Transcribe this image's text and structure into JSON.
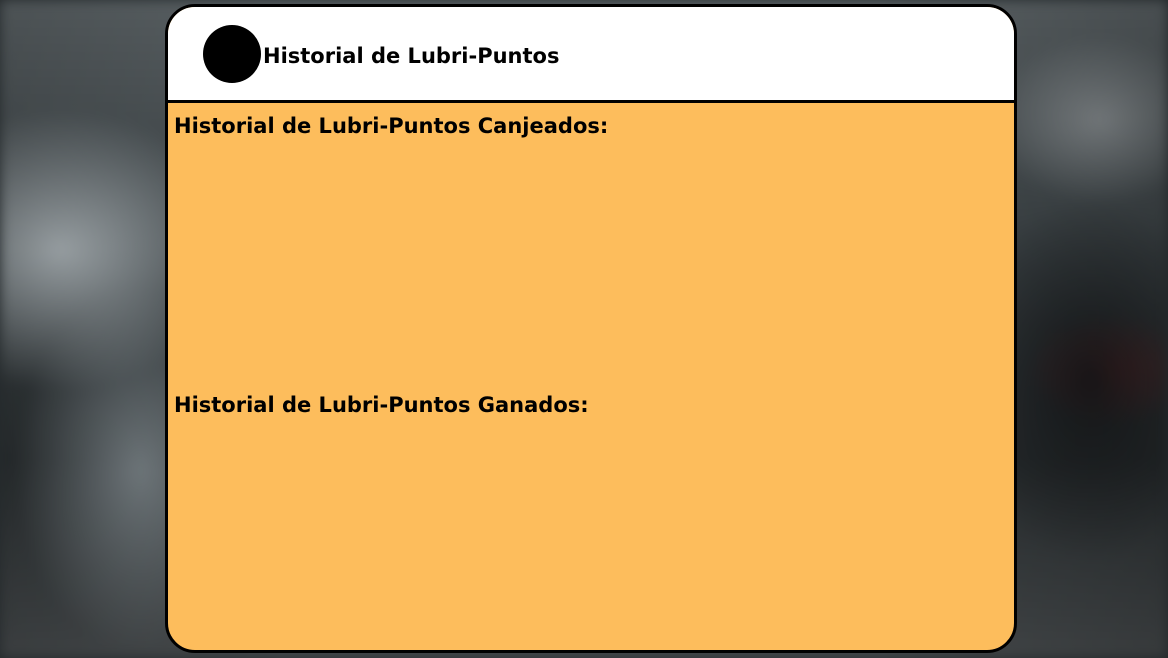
{
  "header": {
    "title": "Historial de Lubri-Puntos"
  },
  "sections": {
    "redeemed": {
      "title": "Historial de Lubri-Puntos Canjeados:",
      "items": []
    },
    "earned": {
      "title": "Historial de Lubri-Puntos Ganados:",
      "items": []
    }
  },
  "colors": {
    "panel": "#fdbd5c",
    "header": "#ffffff",
    "border": "#000000"
  }
}
